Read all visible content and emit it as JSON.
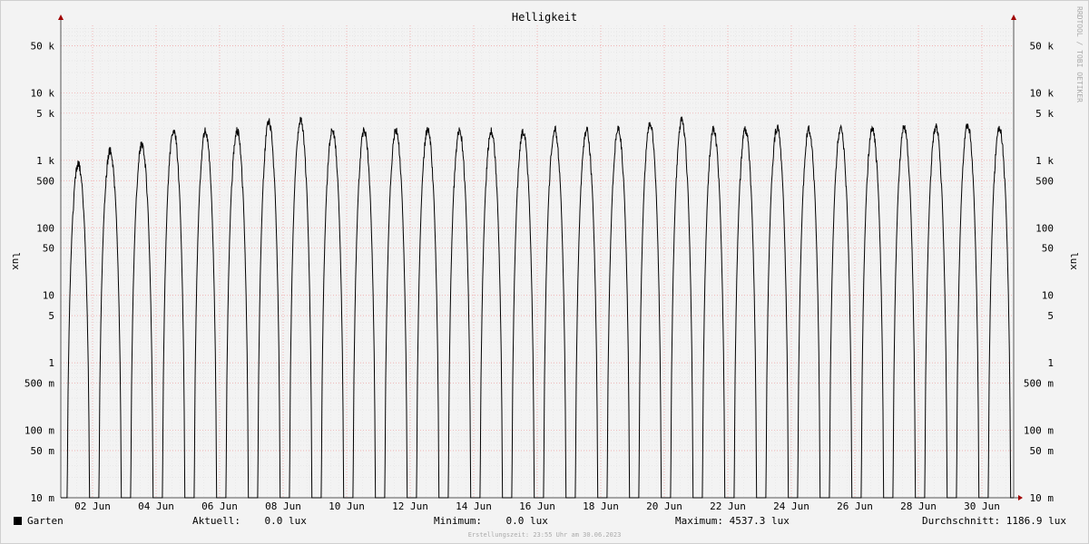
{
  "chart_data": {
    "type": "line",
    "title": "Helligkeit",
    "ylabel": "lux",
    "yscale": "log",
    "ylim": [
      0.01,
      100000
    ],
    "y_ticks": [
      {
        "v": 50000,
        "label": "50 k"
      },
      {
        "v": 10000,
        "label": "10 k"
      },
      {
        "v": 5000,
        "label": "5 k"
      },
      {
        "v": 1000,
        "label": "1 k"
      },
      {
        "v": 500,
        "label": "500"
      },
      {
        "v": 100,
        "label": "100"
      },
      {
        "v": 50,
        "label": "50"
      },
      {
        "v": 10,
        "label": "10"
      },
      {
        "v": 5,
        "label": "5"
      },
      {
        "v": 1,
        "label": "1"
      },
      {
        "v": 0.5,
        "label": "500 m"
      },
      {
        "v": 0.1,
        "label": "100 m"
      },
      {
        "v": 0.05,
        "label": "50 m"
      },
      {
        "v": 0.01,
        "label": "10 m"
      }
    ],
    "xlim": [
      "2023-06-01",
      "2023-07-01"
    ],
    "x_ticks": [
      "02 Jun",
      "04 Jun",
      "06 Jun",
      "08 Jun",
      "10 Jun",
      "12 Jun",
      "14 Jun",
      "16 Jun",
      "18 Jun",
      "20 Jun",
      "22 Jun",
      "24 Jun",
      "26 Jun",
      "28 Jun",
      "30 Jun"
    ],
    "grid": true,
    "series": [
      {
        "name": "Garten",
        "color": "#000000",
        "daily_peak_lux": [
          1000,
          1600,
          2000,
          3300,
          3200,
          3200,
          4300,
          4500,
          3300,
          3200,
          3200,
          3300,
          3200,
          3100,
          3100,
          3300,
          3200,
          3300,
          4100,
          4537.3,
          3300,
          3300,
          3500,
          3300,
          3300,
          3400,
          3600,
          3600,
          3900,
          3500
        ],
        "night_value_lux": 0.0
      }
    ]
  },
  "watermark": "RRDTOOL / TOBI OETIKER",
  "legend": {
    "series_name": "Garten",
    "current": "Aktuell:    0.0 lux",
    "minimum": "Minimum:    0.0 lux",
    "maximum": "Maximum: 4537.3 lux",
    "average": "Durchschnitt: 1186.9 lux"
  },
  "footer": "Erstellungszeit: 23:55 Uhr am 30.06.2023"
}
